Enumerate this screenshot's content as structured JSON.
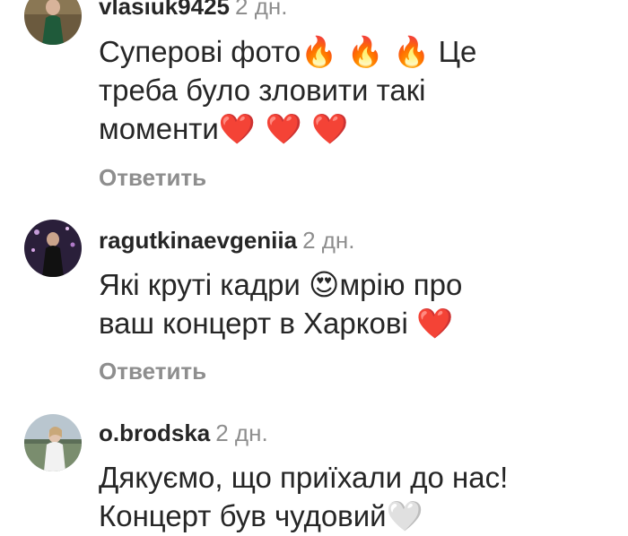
{
  "comments": [
    {
      "username": "vlasiuk9425",
      "time": "2 дн.",
      "lines": [
        [
          "Суперові фото",
          "🔥 🔥 🔥",
          " Це"
        ],
        [
          "треба було зловити такі"
        ],
        [
          "моменти",
          "❤️ ❤️ ❤️"
        ]
      ],
      "reply_label": "Ответить"
    },
    {
      "username": "ragutkinaevgeniia",
      "time": "2 дн.",
      "lines": [
        [
          "Які круті кадри ",
          "😍",
          "мрію про"
        ],
        [
          "ваш концерт в Харкові ",
          "❤️"
        ]
      ],
      "reply_label": "Ответить"
    },
    {
      "username": "o.brodska",
      "time": "2 дн.",
      "lines": [
        [
          "Дякуємо, що приїхали до нас!"
        ],
        [
          "Концерт був чудовий",
          "🤍"
        ]
      ]
    }
  ],
  "colors": {
    "text": "#262626",
    "secondary": "#8e8e8e"
  }
}
